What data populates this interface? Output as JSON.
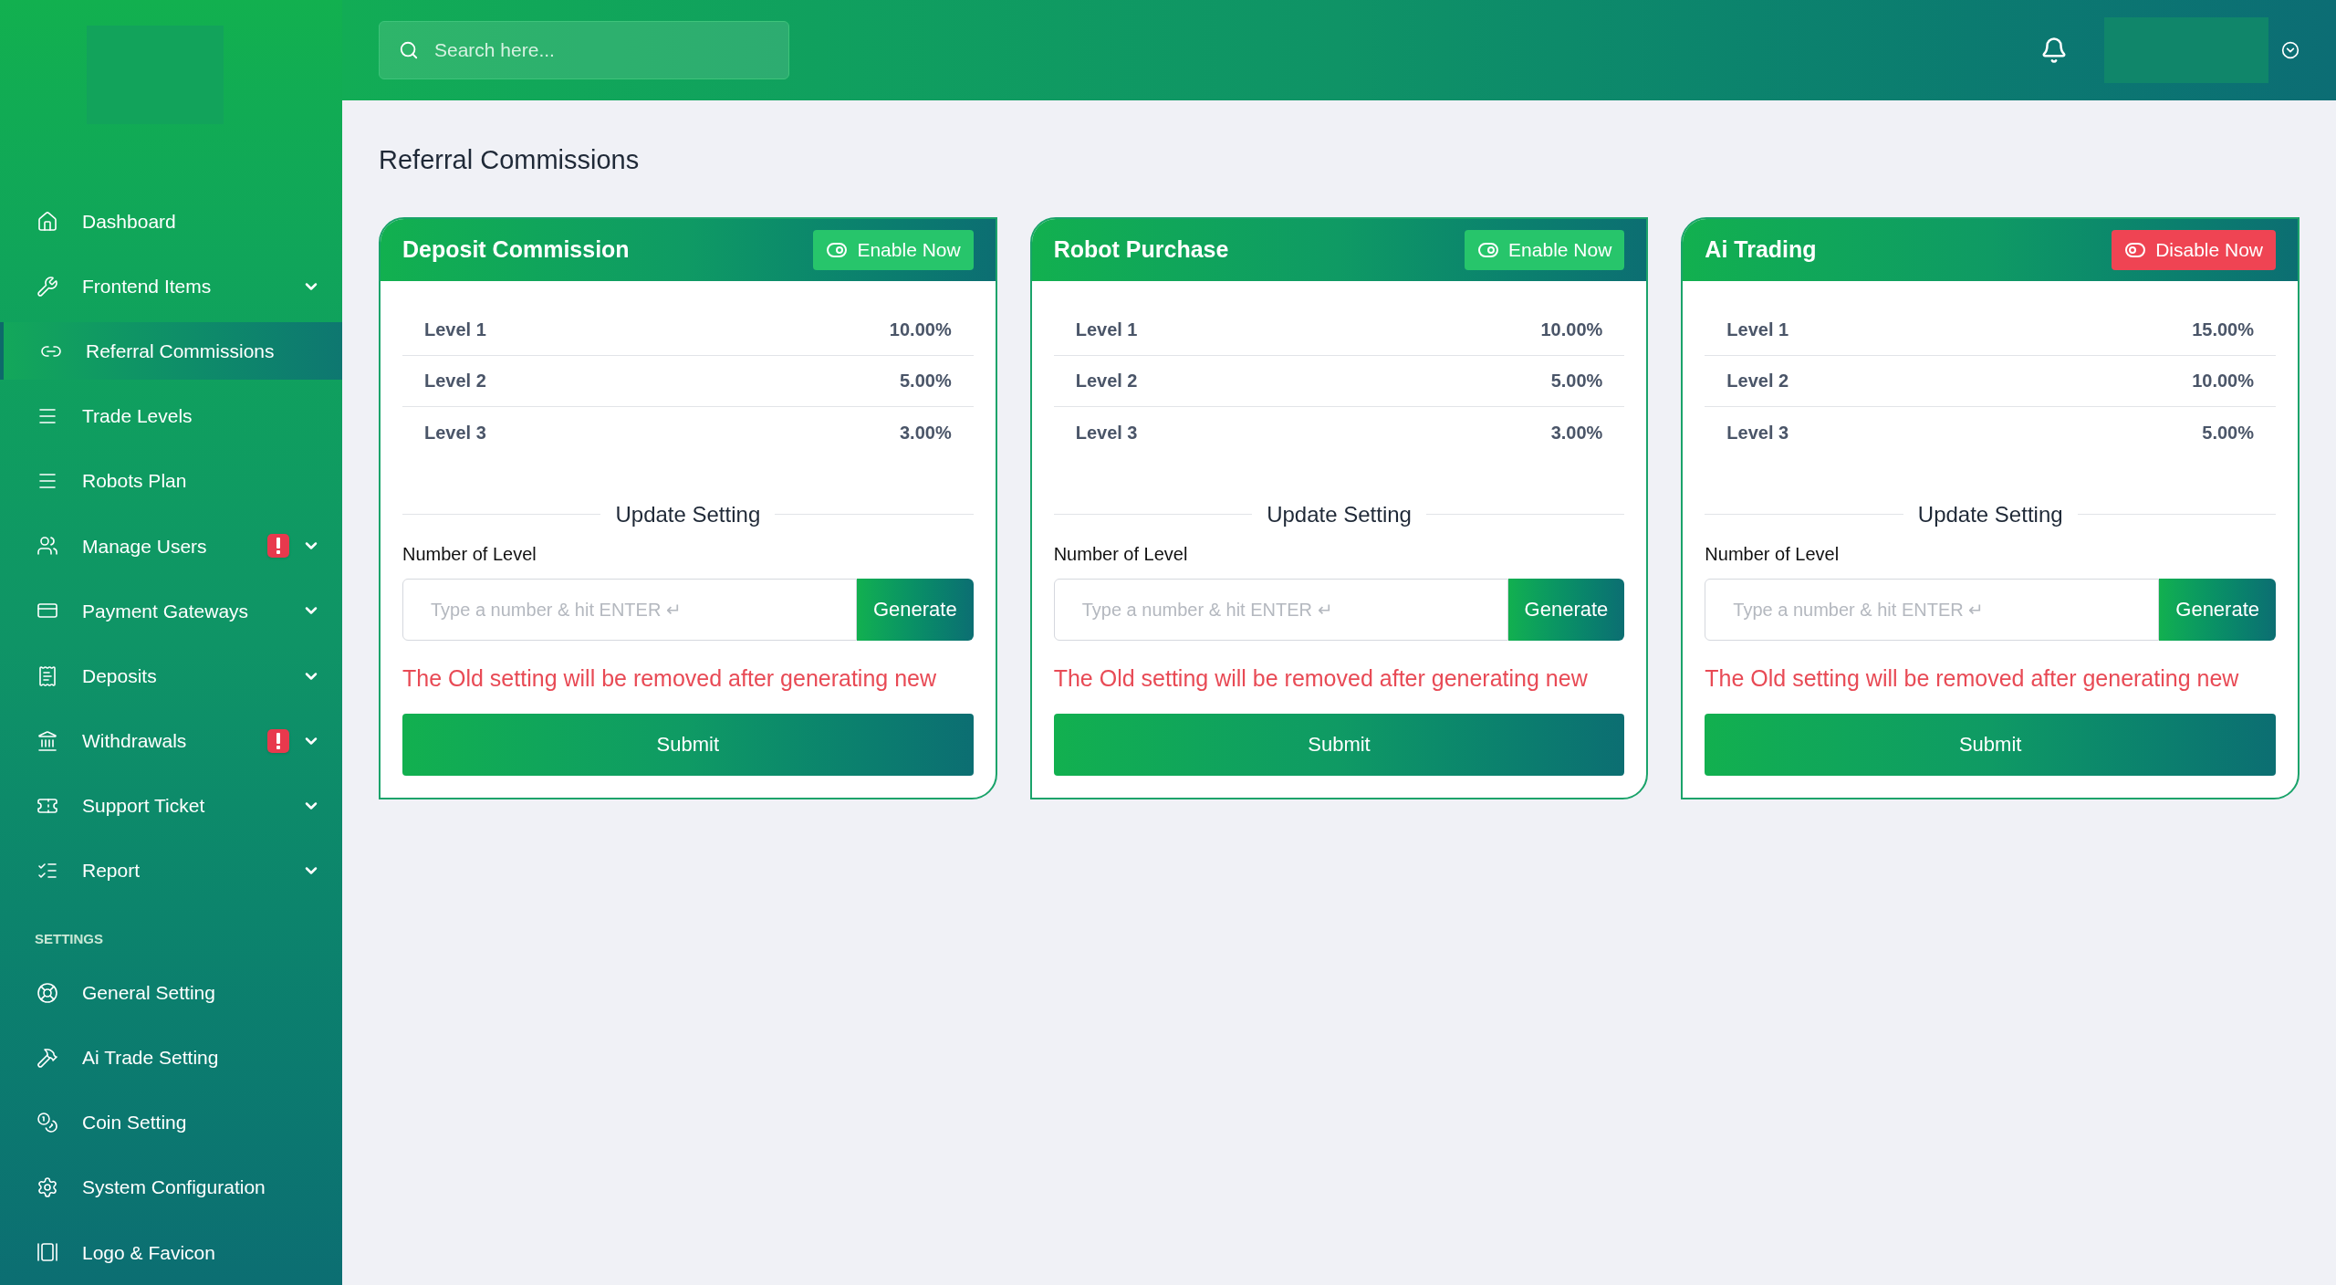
{
  "search": {
    "placeholder": "Search here..."
  },
  "sidebar": {
    "items": [
      {
        "kind": "link",
        "label": "Dashboard",
        "selected": false,
        "expandable": false,
        "alert": false
      },
      {
        "kind": "link",
        "label": "Frontend Items",
        "selected": false,
        "expandable": true,
        "alert": false
      },
      {
        "kind": "link",
        "label": "Referral Commissions",
        "selected": true,
        "expandable": false,
        "alert": false
      },
      {
        "kind": "link",
        "label": "Trade Levels",
        "selected": false,
        "expandable": false,
        "alert": false
      },
      {
        "kind": "link",
        "label": "Robots Plan",
        "selected": false,
        "expandable": false,
        "alert": false
      },
      {
        "kind": "link",
        "label": "Manage Users",
        "selected": false,
        "expandable": true,
        "alert": true
      },
      {
        "kind": "link",
        "label": "Payment Gateways",
        "selected": false,
        "expandable": true,
        "alert": false
      },
      {
        "kind": "link",
        "label": "Deposits",
        "selected": false,
        "expandable": true,
        "alert": false
      },
      {
        "kind": "link",
        "label": "Withdrawals",
        "selected": false,
        "expandable": true,
        "alert": true
      },
      {
        "kind": "link",
        "label": "Support Ticket",
        "selected": false,
        "expandable": true,
        "alert": false
      },
      {
        "kind": "link",
        "label": "Report",
        "selected": false,
        "expandable": true,
        "alert": false
      },
      {
        "kind": "section",
        "label": "SETTINGS"
      },
      {
        "kind": "link",
        "label": "General Setting",
        "selected": false,
        "expandable": false,
        "alert": false
      },
      {
        "kind": "link",
        "label": "Ai Trade Setting",
        "selected": false,
        "expandable": false,
        "alert": false
      },
      {
        "kind": "link",
        "label": "Coin Setting",
        "selected": false,
        "expandable": false,
        "alert": false
      },
      {
        "kind": "link",
        "label": "System Configuration",
        "selected": false,
        "expandable": false,
        "alert": false
      },
      {
        "kind": "link",
        "label": "Logo & Favicon",
        "selected": false,
        "expandable": false,
        "alert": false
      }
    ]
  },
  "page_title": "Referral Commissions",
  "cards": [
    {
      "title": "Deposit Commission",
      "toggle": {
        "label": "Enable Now",
        "enabled": false
      },
      "levels": [
        {
          "label": "Level 1",
          "value": "10.00%"
        },
        {
          "label": "Level 2",
          "value": "5.00%"
        },
        {
          "label": "Level 3",
          "value": "3.00%"
        }
      ],
      "section_title": "Update Setting",
      "field_label": "Number of Level",
      "placeholder": "Type a number & hit ENTER ↵",
      "generate": "Generate",
      "warning": "The Old setting will be removed after generating new",
      "submit": "Submit"
    },
    {
      "title": "Robot Purchase",
      "toggle": {
        "label": "Enable Now",
        "enabled": false
      },
      "levels": [
        {
          "label": "Level 1",
          "value": "10.00%"
        },
        {
          "label": "Level 2",
          "value": "5.00%"
        },
        {
          "label": "Level 3",
          "value": "3.00%"
        }
      ],
      "section_title": "Update Setting",
      "field_label": "Number of Level",
      "placeholder": "Type a number & hit ENTER ↵",
      "generate": "Generate",
      "warning": "The Old setting will be removed after generating new",
      "submit": "Submit"
    },
    {
      "title": "Ai Trading",
      "toggle": {
        "label": "Disable Now",
        "enabled": true
      },
      "levels": [
        {
          "label": "Level 1",
          "value": "15.00%"
        },
        {
          "label": "Level 2",
          "value": "10.00%"
        },
        {
          "label": "Level 3",
          "value": "5.00%"
        }
      ],
      "section_title": "Update Setting",
      "field_label": "Number of Level",
      "placeholder": "Type a number & hit ENTER ↵",
      "generate": "Generate",
      "warning": "The Old setting will be removed after generating new",
      "submit": "Submit"
    }
  ]
}
